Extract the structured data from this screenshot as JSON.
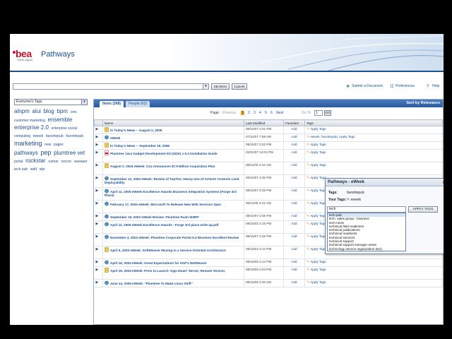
{
  "app": {
    "brand": "bea",
    "brand_sub": "Think Liquid",
    "title": "Pathways"
  },
  "search": {
    "value": "",
    "search_label": "SEARCH",
    "clear_label": "CLEAR"
  },
  "top_links": {
    "submit": "Submit a Document",
    "preferences": "Preferences",
    "help": "Help"
  },
  "tag_filter": {
    "selected": "Everyone's Tags"
  },
  "tag_cloud": [
    {
      "text": "alnpm",
      "size": 3
    },
    {
      "text": "alui",
      "size": 3
    },
    {
      "text": "blog",
      "size": 3
    },
    {
      "text": "bpm",
      "size": 3
    },
    {
      "text": "cms",
      "size": 1
    },
    {
      "text": "customer marketing",
      "size": 1
    },
    {
      "text": "ensemble",
      "size": 3
    },
    {
      "text": "enterprise 2.0",
      "size": 3
    },
    {
      "text": "enterprise social",
      "size": 1
    },
    {
      "text": "computing",
      "size": 1
    },
    {
      "text": "eweek",
      "size": 1
    },
    {
      "text": "favoritepub",
      "size": 1
    },
    {
      "text": "favoritepub",
      "size": 1
    },
    {
      "text": "marketing",
      "size": 4
    },
    {
      "text": "new",
      "size": 1
    },
    {
      "text": "pages",
      "size": 1
    },
    {
      "text": "pathways",
      "size": 3
    },
    {
      "text": "pep",
      "size": 4
    },
    {
      "text": "plumtree vet",
      "size": 3
    },
    {
      "text": "portal",
      "size": 1
    },
    {
      "text": "rockstar",
      "size": 3
    },
    {
      "text": "runner",
      "size": 1
    },
    {
      "text": "soccer",
      "size": 1
    },
    {
      "text": "sweeper",
      "size": 1
    },
    {
      "text": "tech pub",
      "size": 1
    },
    {
      "text": "wdd",
      "size": 1
    },
    {
      "text": "wlp",
      "size": 1
    }
  ],
  "tabs": {
    "items": "Items (268)",
    "people": "People (63)",
    "sort": "Sort by Relevance"
  },
  "pager": {
    "label": "Page:",
    "previous": "Previous",
    "pages": [
      "1",
      "2",
      "3",
      "4",
      "5",
      "6"
    ],
    "current": "1",
    "next": "Next",
    "goto_label": "Go To",
    "goto_value": "1",
    "go": "GO"
  },
  "table": {
    "headers": [
      "",
      "Name",
      "Last Modified",
      "Favorites",
      "Tags"
    ],
    "rows": [
      {
        "icon": "doc",
        "name": "In Today's News -- August 2, 2006",
        "modified": "08/15/07 3:31 PM",
        "fav": "Add",
        "tags": "Apply Tags"
      },
      {
        "icon": "globe",
        "name": "eWeek",
        "modified": "07/24/07 7:58 AM",
        "fav": "Add",
        "tags": "eweek, favoritepub, Apply Tags"
      },
      {
        "icon": "doc",
        "name": "In Today's News -- September 19, 2006",
        "modified": "08/15/07 3:32 PM",
        "fav": "Add",
        "tags": "Apply Tags"
      },
      {
        "icon": "pdf",
        "name": "Plumtree Java Gadget Development Kit (GDK) v 5.3 Installation Guide",
        "modified": "02/02/07 12:03 PM",
        "fav": "Add",
        "tags": "Apply Tags"
      },
      {
        "icon": "doc",
        "name": "August 2, 2004 eWeek: Cox Announces $7.9 Billion Acquisition Plan",
        "modified": "08/11/05 4:42 AM",
        "fav": "Add",
        "tags": "Apply Tags"
      },
      {
        "icon": "globe",
        "name": "September 12, 2004 eWeek: Review of TopTier; Heavy Use of ActiveX Controls Limit Deployability",
        "modified": "08/15/07 3:30 PM",
        "fav": "Add",
        "tags": "Apply Tags"
      },
      {
        "icon": "globe",
        "name": "April 11, 2005 eWeek Excellence Awards Business Integration Systems (Forge 3rd Place)",
        "modified": "08/15/07 3:48 PM",
        "fav": "Add",
        "tags": "Apply Tags"
      },
      {
        "icon": "globe",
        "name": "February 17, 2004 eWeek: Microsoft To Release New Web Services Spec",
        "modified": "08/11/05 4:41 AM",
        "fav": "Add",
        "tags": "Apply Tags"
      },
      {
        "icon": "globe",
        "name": "September 19, 2003 eWeek Review: Plumtree Rush W3RP",
        "modified": "08/15/07 3:36 PM",
        "fav": "Add",
        "tags": "Apply Tags"
      },
      {
        "icon": "globe",
        "name": "April 11, 2005 eWeek Excellence Awards - Forge 3rd place write up.pdf",
        "modified": "08/16/03 3:15 PM",
        "fav": "Add",
        "tags": "Apply Tags"
      },
      {
        "icon": "globe",
        "name": "November 4, 2003 eWeek: Plumtree Corporate Portal 5.4 Receives Excellent Review",
        "modified": "08/15/07 3:45 PM",
        "fav": "Add",
        "tags": "Apply Tags"
      },
      {
        "icon": "doc",
        "name": "April 5, 2004 eWeek: SoftWeaver Moving to a Service-Oriented Architecture",
        "modified": "08/15/03 3:14 PM",
        "fav": "Add",
        "tags": "Apply Tags"
      },
      {
        "icon": "globe",
        "name": "April 16, 2004 eWeek: Great Expectations for SAP's NetWeaver",
        "modified": "08/16/05 3:14 PM",
        "fav": "Add",
        "tags": "Apply Tags"
      },
      {
        "icon": "doc",
        "name": "April 16, 2004 eWeek: Preis to Launch 'App-Smart' Server, Remote Version",
        "modified": "08/16/05 3:43 PM",
        "fav": "Add",
        "tags": "Apply Tags"
      },
      {
        "icon": "globe",
        "name": "June 14, 2005 eWeek: \"Plumtree To Make Linux Shift\"",
        "modified": "08/15/05 4:40 AM",
        "fav": "Add",
        "tags": "Apply Tags"
      }
    ]
  },
  "popup": {
    "title": "Pathways - eWeek",
    "tags_label": "Tags:",
    "tags_value": "favoritepub",
    "your_tags_label": "Your Tags:",
    "your_tags_value": "eweek",
    "input_value": "tech",
    "apply_label": "APPLY TAGS",
    "suggestions": [
      "tech pub",
      "tech. sales group - lossnesc",
      "tech-news",
      "technical field readiness",
      "technical publications",
      "technical readiness",
      "technical services",
      "technical support",
      "technical support manager areas",
      "technology service organization (tso)"
    ],
    "selected_suggestion": 0
  },
  "colors": {
    "brand_blue": "#1d4f93",
    "brand_red": "#c8102e",
    "accent_orange": "#f5a623"
  }
}
